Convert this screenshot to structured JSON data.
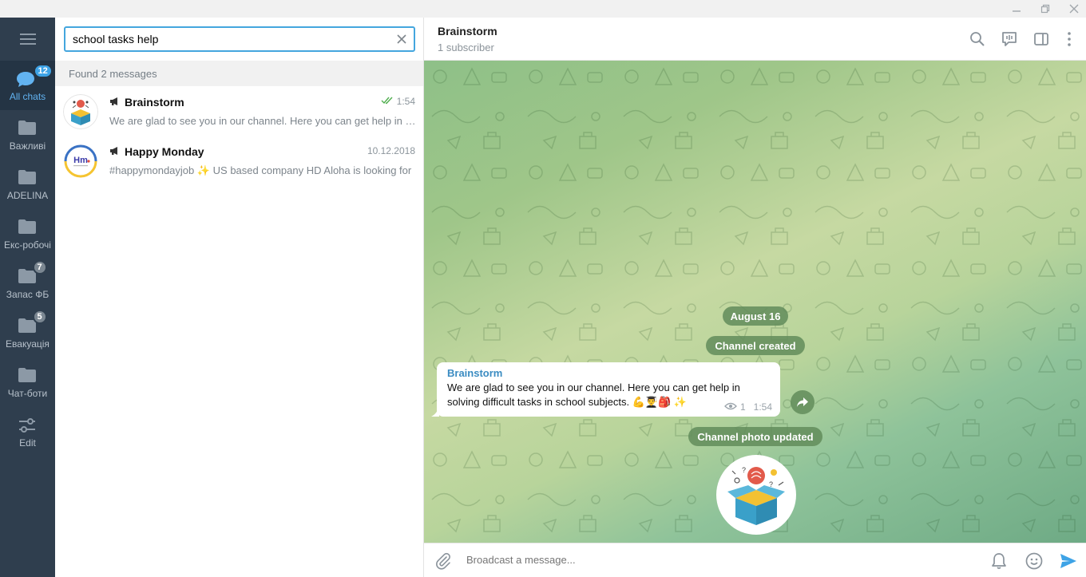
{
  "window": {
    "minimize_icon": "minimize-icon",
    "restore_icon": "restore-icon",
    "close_icon": "close-icon"
  },
  "folders": {
    "menu_icon": "hamburger-menu-icon",
    "items": [
      {
        "label": "All chats",
        "badge": "12",
        "icon": "chats-icon",
        "active": true
      },
      {
        "label": "Важливі",
        "badge": "",
        "icon": "folder-icon"
      },
      {
        "label": "ADELINA",
        "badge": "",
        "icon": "folder-icon"
      },
      {
        "label": "Екс-робочі",
        "badge": "",
        "icon": "folder-icon"
      },
      {
        "label": "Запас ФБ",
        "badge": "7",
        "icon": "folder-icon"
      },
      {
        "label": "Евакуація",
        "badge": "5",
        "icon": "folder-icon"
      },
      {
        "label": "Чат-боти",
        "badge": "",
        "icon": "folder-icon"
      },
      {
        "label": "Edit",
        "badge": "",
        "icon": "edit-sliders-icon"
      }
    ]
  },
  "search": {
    "value": "school tasks help",
    "clear_icon": "close-icon"
  },
  "results": {
    "found_label": "Found 2 messages",
    "items": [
      {
        "name": "Brainstorm",
        "time": "1:54",
        "read": true,
        "preview": "We are glad to see you in our channel. Here you can get help in solving difficult tasks in school subjects."
      },
      {
        "name": "Happy Monday",
        "time": "10.12.2018",
        "read": false,
        "preview": "#happymondayjob  ✨ US based company HD Aloha is looking for"
      }
    ]
  },
  "chat": {
    "title": "Brainstorm",
    "subtitle": "1 subscriber",
    "header_icons": [
      "search-icon",
      "live-stream-icon",
      "sidebar-toggle-icon",
      "more-vertical-icon"
    ],
    "date_label": "August 16",
    "service_created": "Channel created",
    "service_photo": "Channel photo updated",
    "message": {
      "author": "Brainstorm",
      "text": "We are glad to see you in our channel. Here you can get help in solving difficult tasks in school subjects. 💪👨‍🎓🎒 ✨",
      "views": "1",
      "time": "1:54"
    }
  },
  "composer": {
    "placeholder": "Broadcast a message...",
    "icons": [
      "attach-icon",
      "bell-icon",
      "emoji-icon",
      "send-icon"
    ]
  },
  "colors": {
    "accent": "#3ea3e6",
    "sidebar": "#2f3e4e",
    "service_bg": "#628c5a"
  }
}
